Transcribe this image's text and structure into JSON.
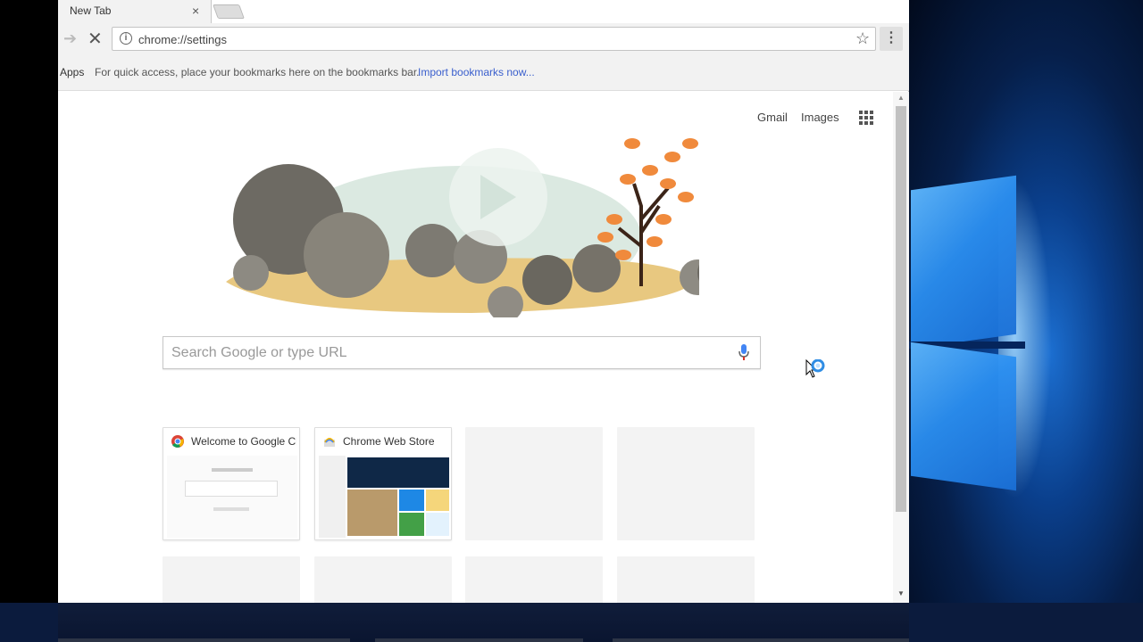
{
  "tab": {
    "title": "New Tab",
    "close_glyph": "×"
  },
  "toolbar": {
    "url": "chrome://settings"
  },
  "bookmarks": {
    "apps_label": "Apps",
    "hint": "For quick access, place your bookmarks here on the bookmarks bar.",
    "import_link": "Import bookmarks now..."
  },
  "gbar": {
    "gmail": "Gmail",
    "images": "Images"
  },
  "search": {
    "placeholder": "Search Google or type URL"
  },
  "tiles": [
    {
      "title": "Welcome to Google Chrome",
      "filled": true
    },
    {
      "title": "Chrome Web Store",
      "filled": true
    },
    {
      "title": "",
      "filled": false
    },
    {
      "title": "",
      "filled": false
    },
    {
      "title": "",
      "filled": false
    },
    {
      "title": "",
      "filled": false
    },
    {
      "title": "",
      "filled": false
    },
    {
      "title": "",
      "filled": false
    }
  ],
  "icons": {
    "forward": "forward-arrow-icon",
    "stop": "stop-loading-icon",
    "info": "info-icon",
    "star": "bookmark-star-icon",
    "menu": "chrome-menu-icon",
    "apps_grid": "google-apps-icon",
    "mic": "microphone-icon"
  },
  "colors": {
    "link": "#3a5fcd",
    "tile_empty": "#f3f3f3"
  }
}
